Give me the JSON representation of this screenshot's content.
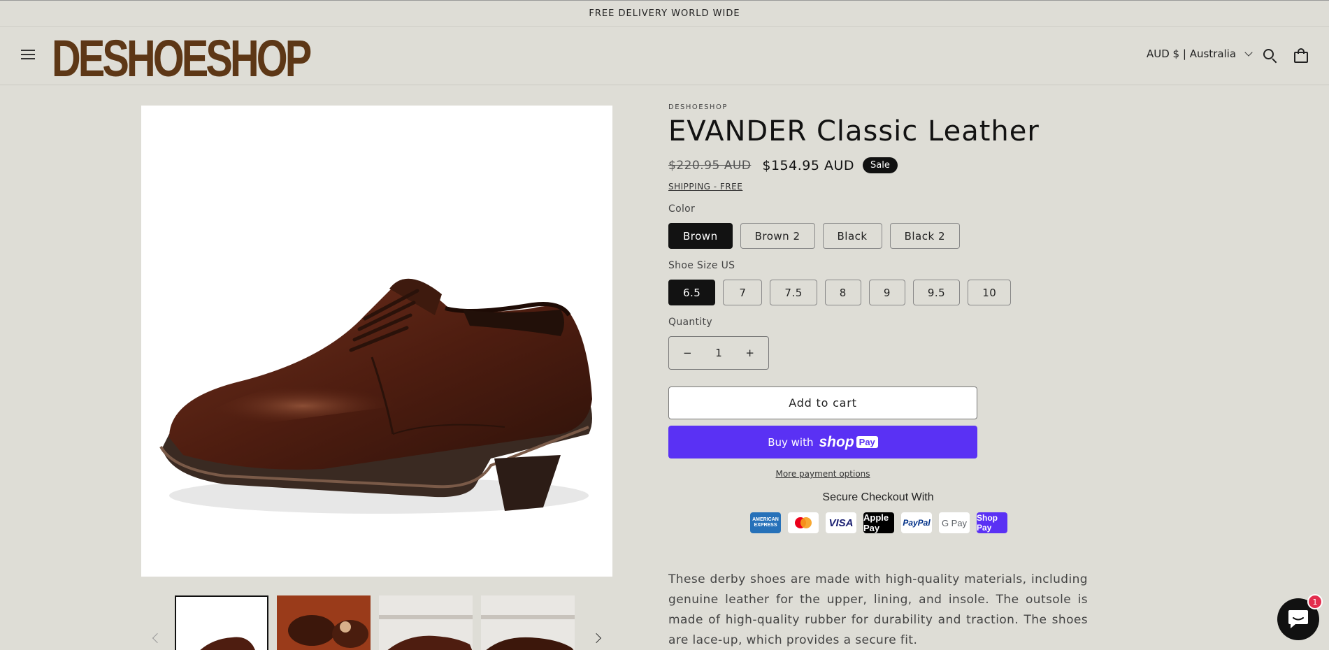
{
  "announcement": "FREE DELIVERY WORLD WIDE",
  "header": {
    "logo": "DESHOESHOP",
    "localization": "AUD $ | Australia"
  },
  "product": {
    "vendor": "DESHOESHOP",
    "title": "EVANDER Classic Leather",
    "price_compare": "$220.95 AUD",
    "price_sale": "$154.95 AUD",
    "badge": "Sale",
    "shipping": "SHIPPING - FREE",
    "color_label": "Color",
    "colors": [
      "Brown",
      "Brown 2",
      "Black",
      "Black 2"
    ],
    "color_selected": "Brown",
    "size_label": "Shoe Size US",
    "sizes": [
      "6.5",
      "7",
      "7.5",
      "8",
      "9",
      "9.5",
      "10"
    ],
    "size_selected": "6.5",
    "quantity_label": "Quantity",
    "quantity": "1",
    "minus": "−",
    "plus": "+",
    "add_to_cart": "Add to cart",
    "buy_with": "Buy with",
    "shop_text": "shop",
    "pay_text": "Pay",
    "more_payment": "More payment options",
    "secure_checkout": "Secure Checkout With",
    "payment_methods": [
      "AMERICAN EXPRESS",
      "Mastercard",
      "VISA",
      "Apple Pay",
      "PayPal",
      "G Pay",
      "Shop Pay"
    ],
    "description": "These derby shoes are made with high-quality materials, including genuine leather for the upper, lining, and insole. The outsole is made of high-quality rubber for durability and traction. The shoes are lace-up, which provides a secure fit."
  },
  "chat": {
    "badge_count": "1"
  },
  "colors": {
    "background": "#deddd6",
    "logo": "#5d3716",
    "shop_pay": "#5a31f4",
    "selected": "#121212"
  }
}
